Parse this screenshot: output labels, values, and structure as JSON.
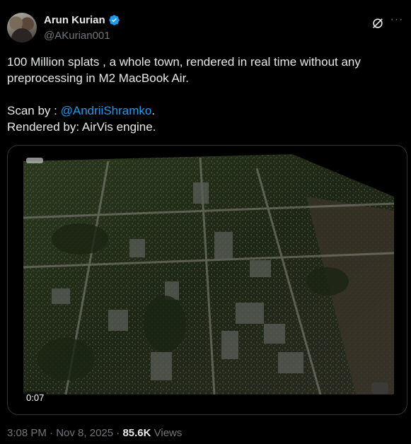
{
  "author": {
    "display_name": "Arun Kurian",
    "handle": "@AKurian001",
    "verified": true,
    "avatar_icon": "avatar-photo"
  },
  "header_icons": {
    "grok": "grok-icon",
    "more": "more-options-icon"
  },
  "tweet": {
    "line1": "100 Million splats , a whole town, rendered in real time without any preprocessing in M2 MacBook Air.",
    "scan_prefix": "Scan by : ",
    "scan_mention": "@AndriiShramko",
    "scan_suffix": ".",
    "rendered_by": "Rendered by: AirVis engine."
  },
  "media": {
    "duration": "0:07",
    "content": "aerial-3d-town-render"
  },
  "meta": {
    "time": "3:08 PM",
    "separator": " · ",
    "date": "Nov 8, 2025",
    "views_count": "85.6K",
    "views_label": " Views"
  },
  "colors": {
    "background": "#000000",
    "text": "#e7e9ea",
    "muted": "#71767b",
    "link": "#1d9bf0",
    "verified": "#1d9bf0"
  }
}
